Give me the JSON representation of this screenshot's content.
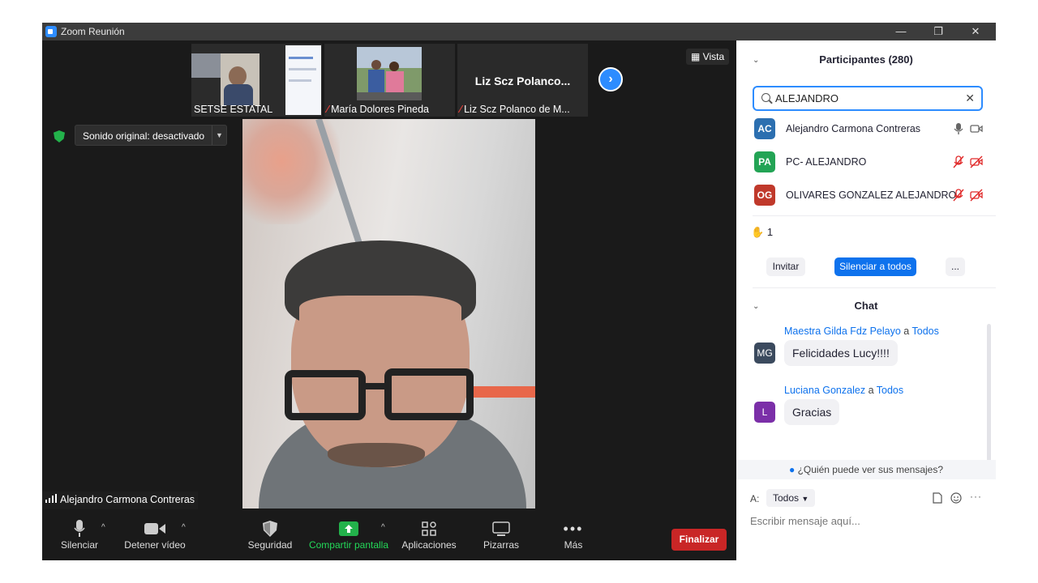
{
  "window": {
    "title": "Zoom Reunión",
    "minimize": "—",
    "restore": "❐",
    "close": "✕"
  },
  "thumbnails": [
    {
      "name": "SETSE ESTATAL",
      "muted": false
    },
    {
      "name": "María Dolores Pineda",
      "muted": true
    },
    {
      "name": "Liz Scz Polanco de M...",
      "display_name": "Liz Scz Polanco...",
      "muted": true
    }
  ],
  "view_button": "Vista",
  "sound_pill": "Sonido original: desactivado",
  "speaker_name": "Alejandro Carmona Contreras",
  "toolbar": {
    "mute": "Silenciar",
    "stop_video": "Detener vídeo",
    "security": "Seguridad",
    "share": "Compartir pantalla",
    "apps": "Aplicaciones",
    "whiteboards": "Pizarras",
    "more": "Más",
    "end": "Finalizar"
  },
  "participants": {
    "title": "Participantes (280)",
    "search_value": "ALEJANDRO",
    "list": [
      {
        "initials": "AC",
        "name": "Alejandro Carmona Contreras",
        "color": "#2c6fb0",
        "muted": false
      },
      {
        "initials": "PA",
        "name": "PC- ALEJANDRO",
        "color": "#23a455",
        "muted": true
      },
      {
        "initials": "OG",
        "name": "OLIVARES GONZALEZ ALEJANDRO",
        "color": "#c0392b",
        "muted": true
      }
    ],
    "raised_hands": "1",
    "invite": "Invitar",
    "mute_all": "Silenciar a todos",
    "more": "..."
  },
  "chat": {
    "title": "Chat",
    "messages": [
      {
        "initials": "MG",
        "sender": "Maestra Gilda Fdz Pelayo",
        "connector": "a",
        "recipient": "Todos",
        "text": "Felicidades Lucy!!!!",
        "color": "#3b4a5e"
      },
      {
        "initials": "L",
        "sender": "Luciana Gonzalez",
        "connector": "a",
        "recipient": "Todos",
        "text": "Gracias",
        "color": "#7b2fa8"
      }
    ],
    "who_can_see": "¿Quién puede ver sus mensajes?",
    "to_label": "A:",
    "to_value": "Todos",
    "input_placeholder": "Escribir mensaje aquí..."
  },
  "colors": {
    "accent": "#2d8cff",
    "end": "#c92626",
    "share_green": "#23d959"
  }
}
